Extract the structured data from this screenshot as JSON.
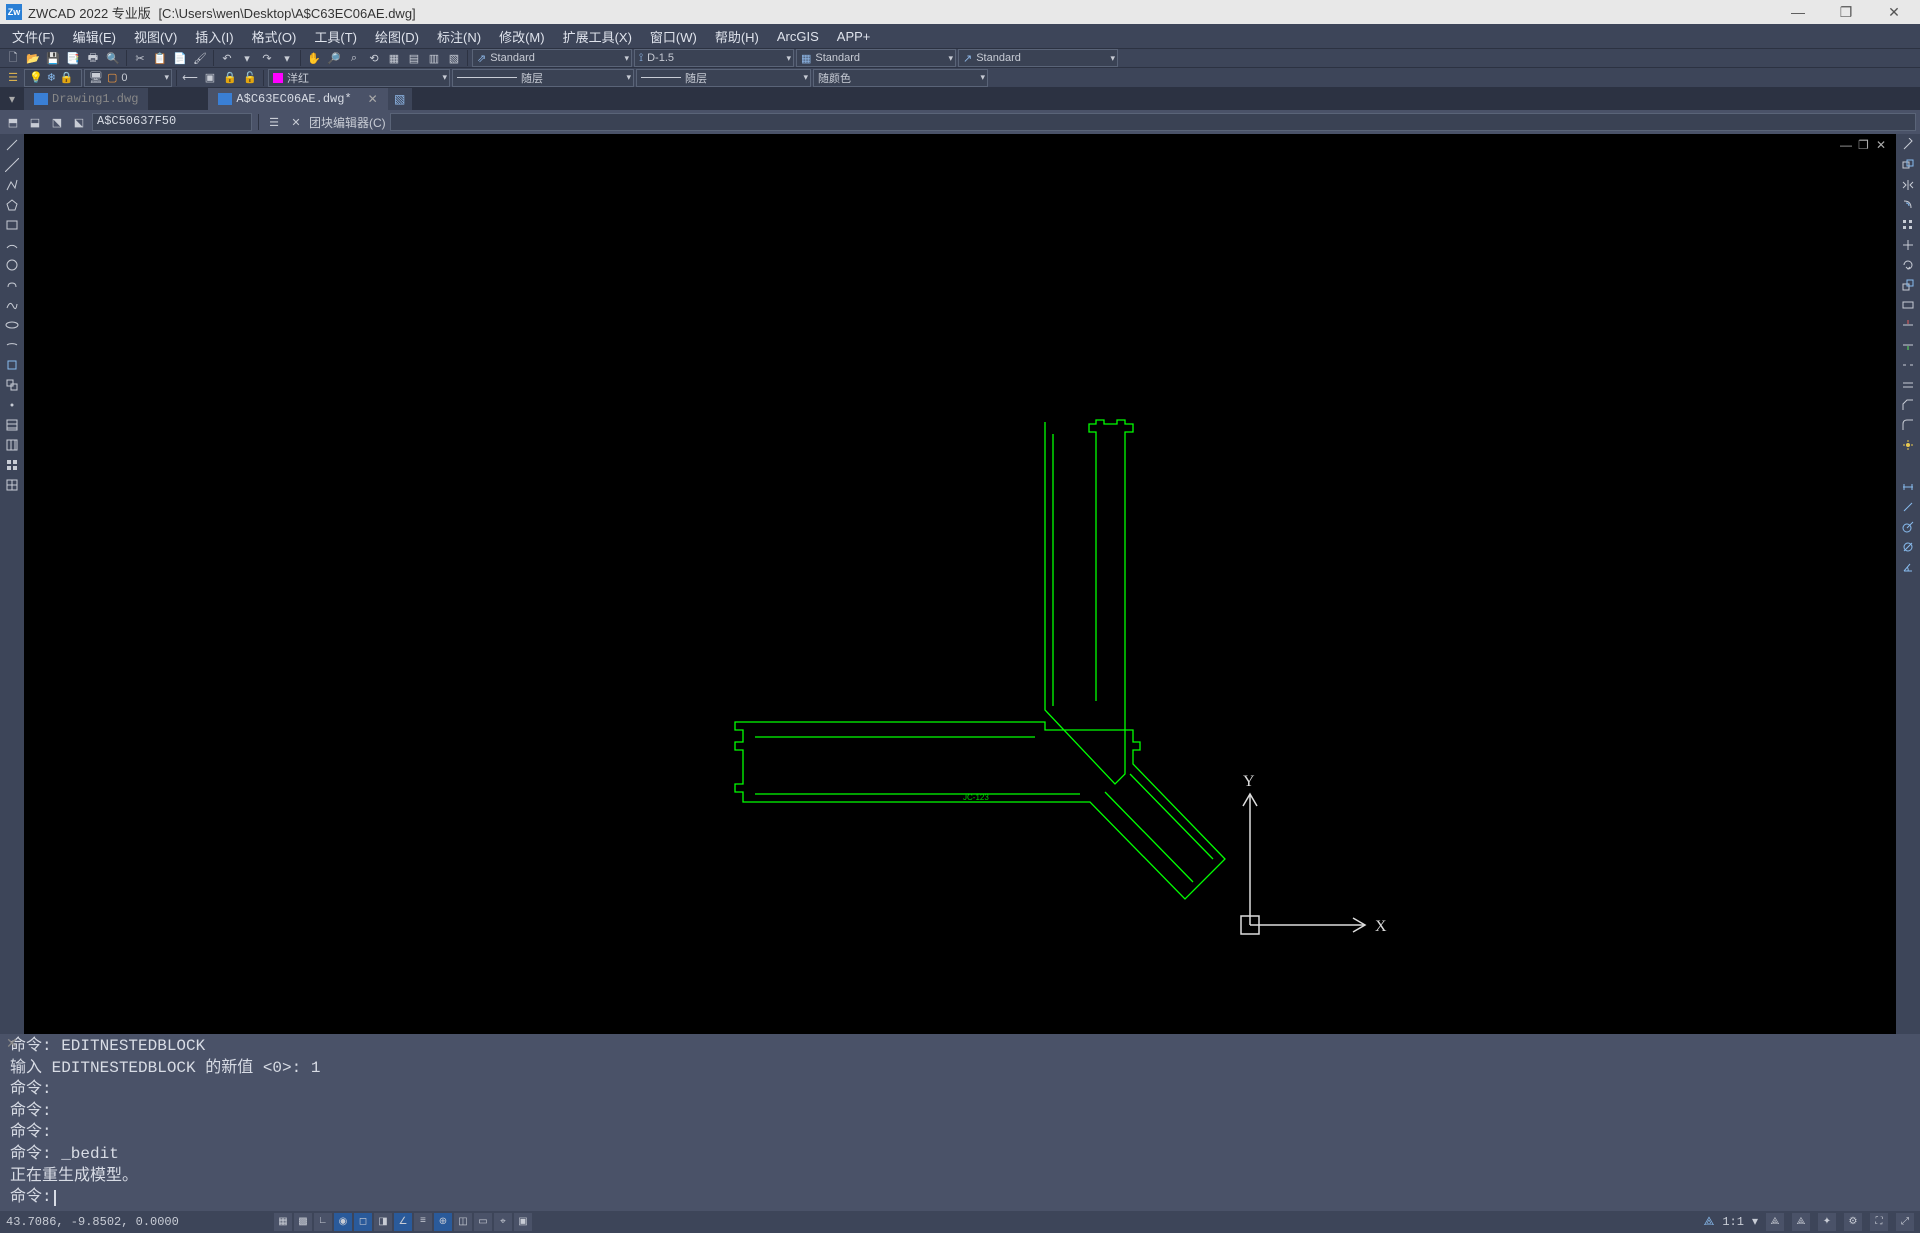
{
  "titlebar": {
    "app": "ZWCAD 2022 专业版",
    "path": "[C:\\Users\\wen\\Desktop\\A$C63EC06AE.dwg]"
  },
  "menu": {
    "file": "文件(F)",
    "edit": "编辑(E)",
    "view": "视图(V)",
    "insert": "插入(I)",
    "format": "格式(O)",
    "tools": "工具(T)",
    "draw": "绘图(D)",
    "dim": "标注(N)",
    "modify": "修改(M)",
    "ext": "扩展工具(X)",
    "window": "窗口(W)",
    "help": "帮助(H)",
    "arcgis": "ArcGIS",
    "appplus": "APP+"
  },
  "style_combo1": "Standard",
  "style_combo2": "D-1.5",
  "style_combo3": "Standard",
  "style_combo4": "Standard",
  "layer_row": {
    "layer_combo": "洋红",
    "ltype": "随层",
    "lweight": "随层",
    "color_combo": "随颜色"
  },
  "doc_tabs": {
    "tab1": "Drawing1.dwg",
    "tab2": "A$C63EC06AE.dwg*"
  },
  "block_bar": {
    "block_name": "A$C50637F50",
    "close_label": "团块编辑器(C)"
  },
  "drawing_label": "JC-123",
  "ucs": {
    "x": "X",
    "y": "Y"
  },
  "cmd": {
    "l1": "命令: EDITNESTEDBLOCK",
    "l2": "输入 EDITNESTEDBLOCK 的新值 <0>: 1",
    "l3": "命令:",
    "l4": "命令:",
    "l5": "命令:",
    "l6": "命令: _bedit",
    "l7": "正在重生成模型。",
    "prompt": "命令:"
  },
  "status": {
    "coords": "43.7086, -9.8502, 0.0000",
    "scale": "1:1"
  }
}
